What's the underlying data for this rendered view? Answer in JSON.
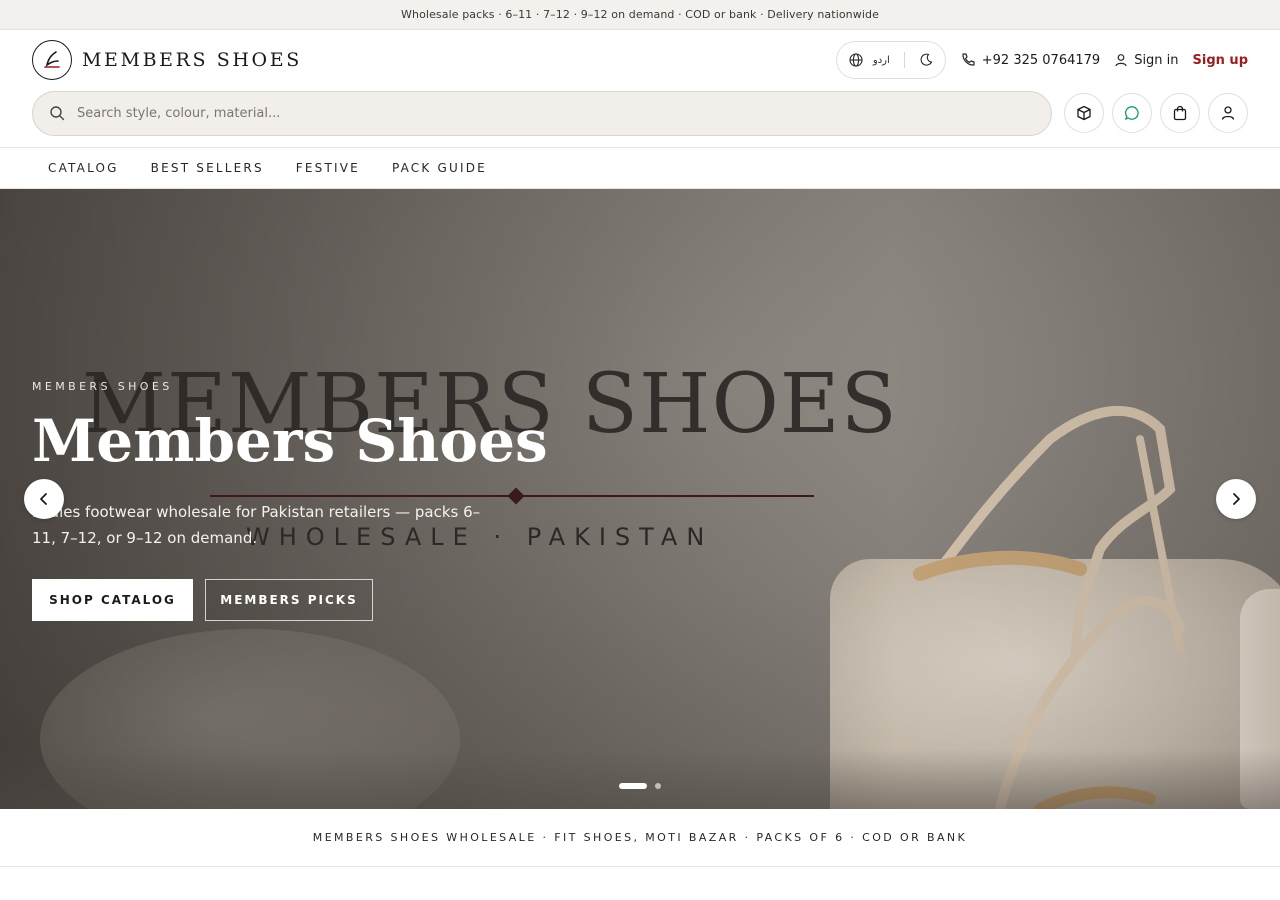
{
  "announcement": "Wholesale packs · 6–11 · 7–12 · 9–12 on demand · COD or bank · Delivery nationwide",
  "brand": {
    "name": "MEMBERS SHOES"
  },
  "header": {
    "language_label": "اردو",
    "phone": "+92 325 0764179",
    "sign_in": "Sign in",
    "sign_up": "Sign up"
  },
  "search": {
    "placeholder": "Search style, colour, material..."
  },
  "nav": {
    "items": [
      {
        "label": "CATALOG"
      },
      {
        "label": "BEST SELLERS"
      },
      {
        "label": "FESTIVE"
      },
      {
        "label": "PACK GUIDE"
      }
    ]
  },
  "hero": {
    "background_wordmark": "MEMBERS SHOES",
    "background_tagline": "WHOLESALE · PAKISTAN",
    "eyebrow": "MEMBERS SHOES",
    "title": "Members Shoes",
    "description": "Ladies footwear wholesale for Pakistan retailers — packs 6–11, 7–12, or 9–12 on demand.",
    "primary_cta": "SHOP CATALOG",
    "secondary_cta": "MEMBERS PICKS",
    "slide_count": 2,
    "active_slide": 1
  },
  "info_strip": "MEMBERS SHOES WHOLESALE · FIT SHOES, MOTI BAZAR · PACKS OF 6 · COD OR BANK",
  "colors": {
    "accent": "#9b1c1c",
    "whatsapp": "#1a9a6e"
  }
}
